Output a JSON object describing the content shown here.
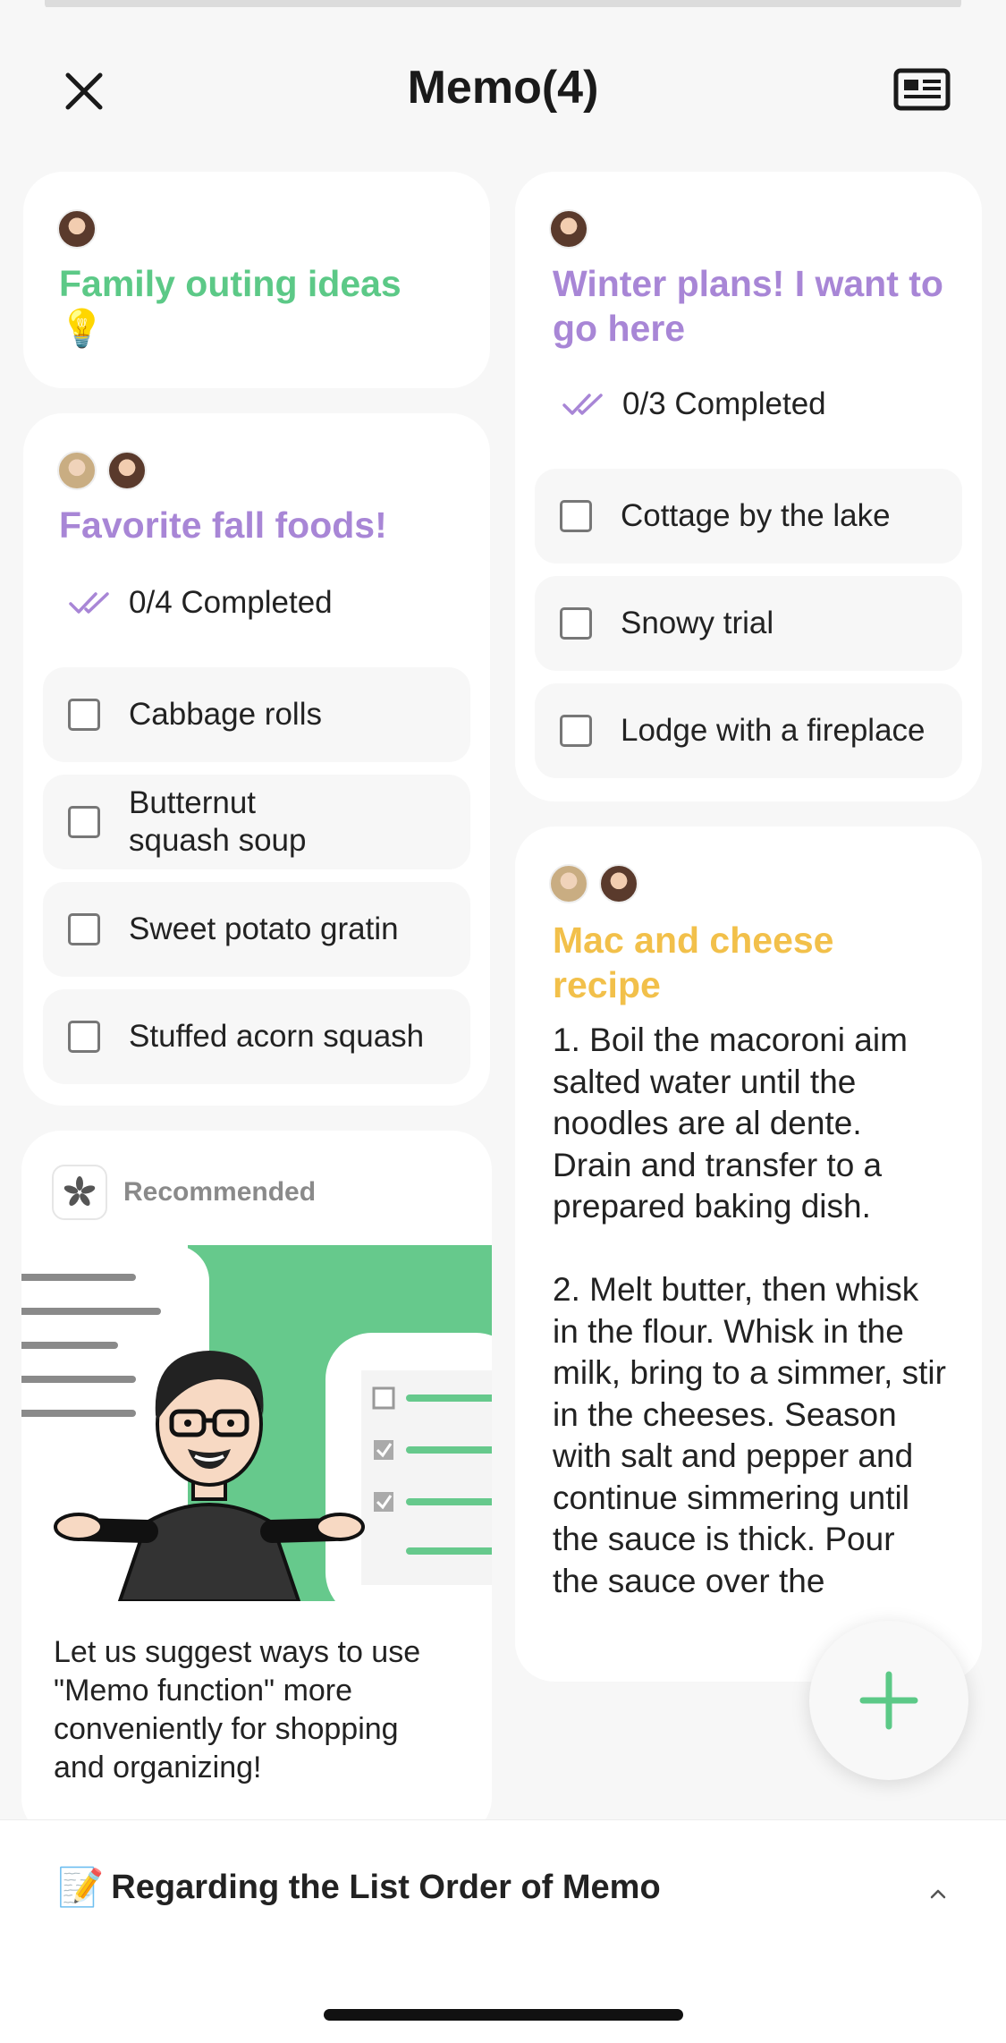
{
  "header": {
    "title": "Memo(4)",
    "close_icon": "close-icon",
    "view_icon": "card-view-icon"
  },
  "memos": [
    {
      "title": "Family outing ideas",
      "emoji": "💡",
      "color": "#5cc987",
      "avatars": [
        "avatar-brown-hair"
      ]
    },
    {
      "title": "Winter plans! I want to go here",
      "color": "#a886d6",
      "avatars": [
        "avatar-brown-hair"
      ],
      "progress": "0/3 Completed",
      "items": [
        "Cottage by the lake",
        "Snowy trial",
        "Lodge with a fireplace"
      ]
    },
    {
      "title": "Favorite fall foods!",
      "color": "#a886d6",
      "avatars": [
        "avatar-blonde-hair",
        "avatar-brown-hair"
      ],
      "progress": "0/4 Completed",
      "items": [
        "Cabbage rolls",
        "Butternut\nsquash soup",
        "Sweet potato gratin",
        "Stuffed acorn squash"
      ]
    },
    {
      "title": "Mac and cheese recipe",
      "color": "#f2c04a",
      "avatars": [
        "avatar-blonde-hair",
        "avatar-brown-hair"
      ],
      "body": "1. Boil the macoroni aim salted water until the noodles are al dente. Drain and transfer to a prepared baking dish.\n\n2. Melt butter, then whisk in the flour. Whisk in the milk, bring to a simmer, stir in the cheeses. Season with salt and pepper and continue simmering until the sauce is thick. Pour the sauce over the"
    }
  ],
  "recommended": {
    "label": "Recommended",
    "text": "Let us suggest ways to use \"Memo function\" more conveniently for shopping and organizing!",
    "accent": "#66c98c"
  },
  "fab": {
    "icon": "plus-icon",
    "color": "#5cc987"
  },
  "footer": {
    "emoji": "📝",
    "notice": "Regarding the List Order of Memo",
    "chevron": "chevron-up-icon"
  }
}
